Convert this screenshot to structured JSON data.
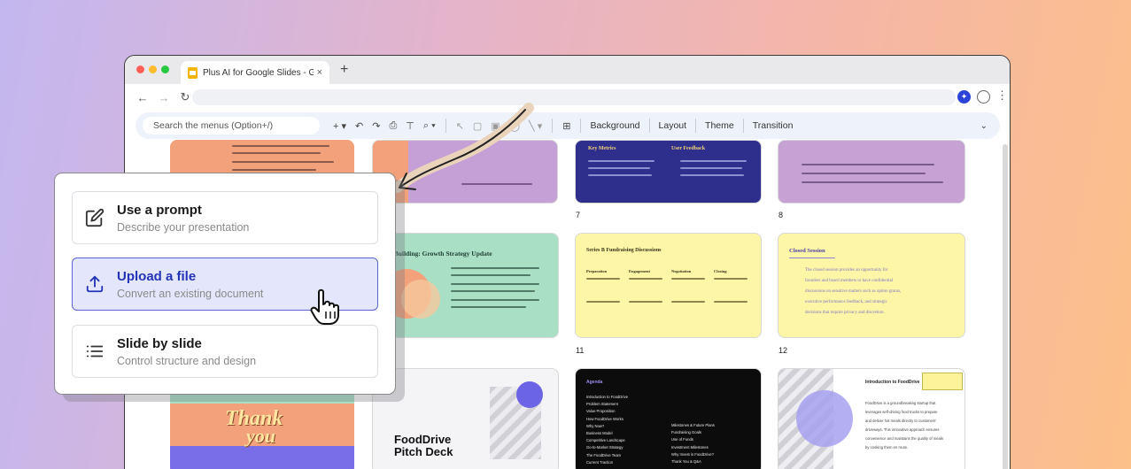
{
  "browser": {
    "tab_title": "Plus AI for Google Slides - Goo",
    "tab_close": "×",
    "new_tab": "+",
    "icons": [
      "back-icon",
      "forward-icon",
      "reload-icon",
      "extension-icon",
      "profile-icon",
      "menu-icon"
    ]
  },
  "toolbar": {
    "search_placeholder": "Search the menus (Option+/)",
    "background": "Background",
    "layout": "Layout",
    "theme": "Theme",
    "transition": "Transition"
  },
  "slides": {
    "num_7": "7",
    "num_8": "8",
    "num_11": "11",
    "num_12": "12",
    "s6": {
      "col_a": "Key Metrics",
      "col_b": "User Feedback"
    },
    "s9": {
      "title": "pany Building: Growth Strategy Update"
    },
    "s10": {
      "title": "Series B Fundraising Discussions",
      "headers": [
        "Preparation",
        "Engagement",
        "Negotiation",
        "Closing"
      ]
    },
    "s11": {
      "title": "Closed Session",
      "body": [
        "The closed session provides an opportunity for",
        "founders and board members to have confidential",
        "discussions on sensitive matters such as option grants,",
        "executive performance feedback, and strategic",
        "decisions that require privacy and discretion."
      ]
    },
    "s12": {
      "line1": "Thank",
      "line2": "you"
    },
    "s13": {
      "line1": "FoodDrive",
      "line2": "Pitch Deck"
    },
    "s14": {
      "heading": "Agenda",
      "left": [
        "Introduction to FoodDrive",
        "Problem Statement",
        "Value Proposition",
        "How FoodDrive Works",
        "Why Now?",
        "Business Model",
        "Competitive Landscape",
        "Go-to-Market Strategy",
        "The FoodDrive Team",
        "Current Traction"
      ],
      "right": [
        "Milestones & Future Plans",
        "Fundraising Goals",
        "Use of Funds",
        "Investment Milestones",
        "Why Invest in FoodDrive?",
        "Thank You & Q&A"
      ]
    },
    "s15": {
      "title": "Introduction to FoodDrive",
      "body": [
        "FoodDrive is a groundbreaking startup that",
        "leverages self-driving food trucks to prepare",
        "and deliver hot meals directly to customers'",
        "driveways. This innovative approach ensures",
        "convenience and maintains the quality of meals",
        "by cooking them en route."
      ]
    }
  },
  "panel": {
    "options": [
      {
        "title": "Use a prompt",
        "subtitle": "Describe your presentation"
      },
      {
        "title": "Upload a file",
        "subtitle": "Convert an existing document"
      },
      {
        "title": "Slide by slide",
        "subtitle": "Control structure and design"
      }
    ]
  },
  "colors": {
    "accent": "#5b63d9",
    "selected_bg": "#e4e7fb",
    "selected_text": "#2233b8"
  }
}
